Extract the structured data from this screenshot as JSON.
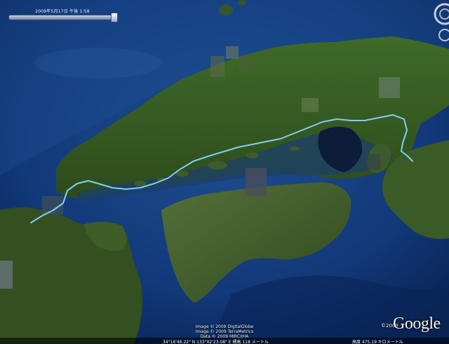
{
  "time_slider": {
    "label": "2009年5月17日 午後 1:58"
  },
  "credits": {
    "line1": "Image © 2009 DigitalGlobe",
    "line2": "Image © 2009 TerraMetrics",
    "line3": "Data © 2009 MIRC/JHA"
  },
  "status": {
    "coords": "34°16'46.22\" N   133°02'23.08\" E   標高   118 メートル",
    "altitude": "高度   475.19 キロメートル"
  },
  "copyright": "©2009",
  "logo": "Google",
  "colors": {
    "sea": "#0b2a5c",
    "land": "#3a5a22",
    "route": "#7fd0f5"
  }
}
